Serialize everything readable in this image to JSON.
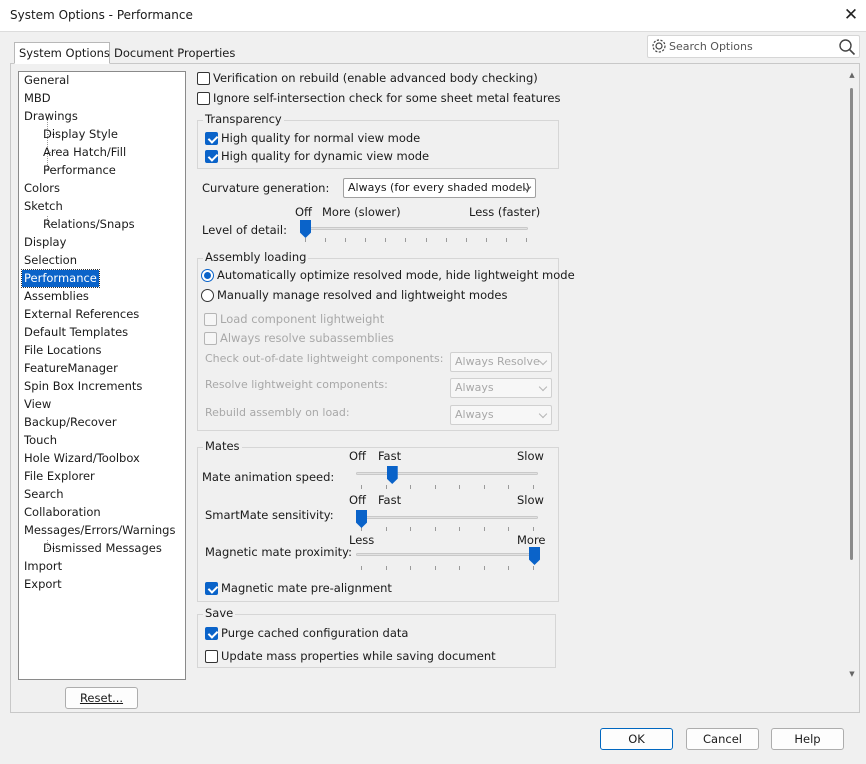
{
  "window": {
    "title": "System Options - Performance",
    "close_icon": "close-icon"
  },
  "tabs": [
    {
      "label": "System Options",
      "active": true
    },
    {
      "label": "Document Properties",
      "active": false
    }
  ],
  "search": {
    "placeholder": "Search Options",
    "icons": [
      "gear-icon",
      "search-icon"
    ]
  },
  "tree": {
    "items": [
      {
        "label": "General",
        "level": 0
      },
      {
        "label": "MBD",
        "level": 0
      },
      {
        "label": "Drawings",
        "level": 0
      },
      {
        "label": "Display Style",
        "level": 1
      },
      {
        "label": "Area Hatch/Fill",
        "level": 1
      },
      {
        "label": "Performance",
        "level": 1
      },
      {
        "label": "Colors",
        "level": 0
      },
      {
        "label": "Sketch",
        "level": 0
      },
      {
        "label": "Relations/Snaps",
        "level": 1
      },
      {
        "label": "Display",
        "level": 0
      },
      {
        "label": "Selection",
        "level": 0
      },
      {
        "label": "Performance",
        "level": 0,
        "selected": true
      },
      {
        "label": "Assemblies",
        "level": 0
      },
      {
        "label": "External References",
        "level": 0
      },
      {
        "label": "Default Templates",
        "level": 0
      },
      {
        "label": "File Locations",
        "level": 0
      },
      {
        "label": "FeatureManager",
        "level": 0
      },
      {
        "label": "Spin Box Increments",
        "level": 0
      },
      {
        "label": "View",
        "level": 0
      },
      {
        "label": "Backup/Recover",
        "level": 0
      },
      {
        "label": "Touch",
        "level": 0
      },
      {
        "label": "Hole Wizard/Toolbox",
        "level": 0
      },
      {
        "label": "File Explorer",
        "level": 0
      },
      {
        "label": "Search",
        "level": 0
      },
      {
        "label": "Collaboration",
        "level": 0
      },
      {
        "label": "Messages/Errors/Warnings",
        "level": 0
      },
      {
        "label": "Dismissed Messages",
        "level": 1
      },
      {
        "label": "Import",
        "level": 0
      },
      {
        "label": "Export",
        "level": 0
      }
    ],
    "reset_label": "Reset..."
  },
  "options": {
    "verification": {
      "label": "Verification on rebuild (enable advanced body checking)",
      "checked": false
    },
    "ignore_self": {
      "label": "Ignore self-intersection check for some sheet metal features",
      "checked": false
    },
    "transparency": {
      "title": "Transparency",
      "normal": {
        "label": "High quality for normal view mode",
        "checked": true
      },
      "dynamic": {
        "label": "High quality for dynamic view mode",
        "checked": true
      }
    },
    "curvature": {
      "label": "Curvature generation:",
      "value": "Always (for every shaded model)"
    },
    "lod": {
      "label": "Level of detail:",
      "off": "Off",
      "more": "More (slower)",
      "less": "Less (faster)",
      "value": 0.0
    },
    "assembly": {
      "title": "Assembly loading",
      "auto": {
        "label": "Automatically optimize resolved mode, hide lightweight mode",
        "selected": true
      },
      "manual": {
        "label": "Manually manage resolved and lightweight modes",
        "selected": false
      },
      "load_light": {
        "label": "Load component lightweight",
        "checked": false
      },
      "always_resolve": {
        "label": "Always resolve subassemblies",
        "checked": false
      },
      "check_ood": {
        "label": "Check out-of-date lightweight components:",
        "value": "Always Resolve"
      },
      "resolve_light": {
        "label": "Resolve lightweight components:",
        "value": "Always"
      },
      "rebuild": {
        "label": "Rebuild assembly on load:",
        "value": "Always"
      }
    },
    "mates": {
      "title": "Mates",
      "anim": {
        "label": "Mate animation speed:",
        "off": "Off",
        "fast": "Fast",
        "slow": "Slow",
        "value": 0.17
      },
      "smart": {
        "label": "SmartMate sensitivity:",
        "off": "Off",
        "fast": "Fast",
        "slow": "Slow",
        "value": 0.0
      },
      "magnetic": {
        "label": "Magnetic mate proximity:",
        "less": "Less",
        "more": "More",
        "value": 1.0
      },
      "prealign": {
        "label": "Magnetic mate pre-alignment",
        "checked": true
      }
    },
    "save": {
      "title": "Save",
      "purge": {
        "label": "Purge cached configuration data",
        "checked": true
      },
      "mass": {
        "label": "Update mass properties while saving document",
        "checked": false
      }
    }
  },
  "buttons": {
    "ok": "OK",
    "cancel": "Cancel",
    "help": "Help"
  }
}
